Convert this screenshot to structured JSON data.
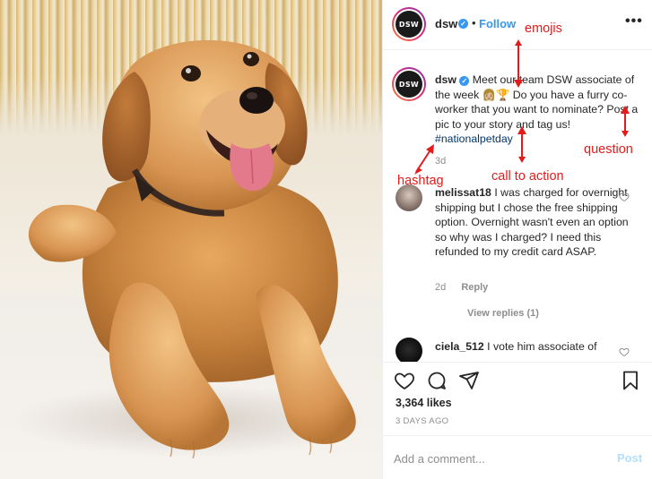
{
  "post": {
    "username": "dsw",
    "verified_glyph": "✓",
    "separator": "•",
    "follow_label": "Follow",
    "more_label": "•••",
    "avatar_text": "DSW",
    "caption": {
      "username": "dsw",
      "text_before_emoji": "Meet our team DSW associate of the week",
      "emojis": [
        "👩🏼",
        "🏆"
      ],
      "text_after_emoji": "Do you have a furry co-worker that you want to nominate? Post a pic to your story and tag us!",
      "hashtag": "#nationalpetday",
      "time": "3d"
    },
    "comments": [
      {
        "username": "melissat18",
        "text": "I was charged for overnight shipping but I chose the free shipping option. Overnight wasn't even an option so why was I charged? I need this refunded to my credit card ASAP.",
        "time": "2d",
        "reply_label": "Reply",
        "view_replies": "View replies (1)"
      },
      {
        "username": "ciela_512",
        "text": "I vote him associate of"
      }
    ],
    "likes": "3,364 likes",
    "date": "3 DAYS AGO",
    "add_comment_placeholder": "Add a comment...",
    "post_label": "Post"
  },
  "annotations": {
    "emojis": "emojis",
    "question": "question",
    "hashtag": "hashtag",
    "call_to_action": "call to action"
  },
  "icons": {
    "heart": "heart-icon",
    "comment": "comment-icon",
    "share": "share-icon",
    "save": "bookmark-icon",
    "more": "more-options-icon"
  },
  "colors": {
    "link_blue": "#3897f0",
    "hashtag": "#00376b",
    "annotation_red": "#e31b1b",
    "muted": "#8e8e8e"
  }
}
